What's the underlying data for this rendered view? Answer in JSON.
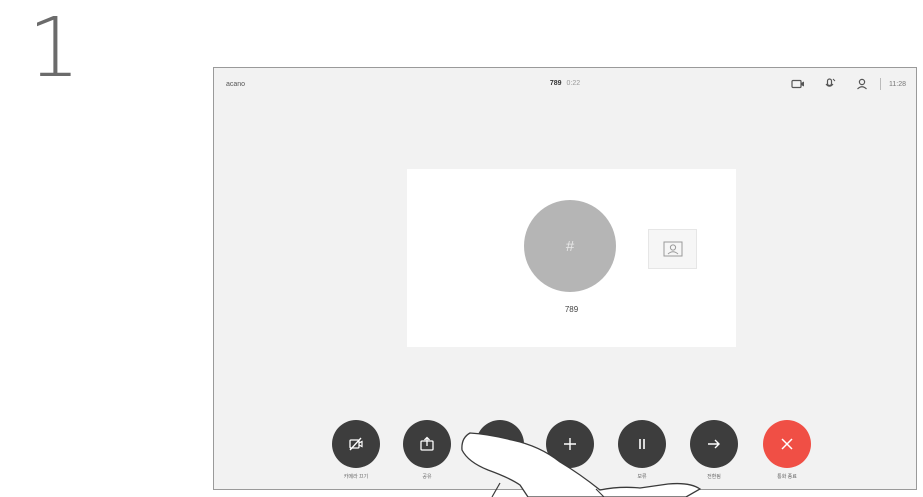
{
  "step_number": "1",
  "topbar": {
    "brand": "acano",
    "call_name": "789",
    "call_duration": "0:22",
    "time": "11:28",
    "icons": [
      "camera-icon",
      "microphone-icon",
      "user-icon"
    ]
  },
  "call": {
    "avatar_symbol": "#",
    "participant_name": "789"
  },
  "controls": [
    {
      "name": "camera-off-button",
      "icon": "camera-off-icon",
      "label": "카메라 끄기",
      "color": "#3d3d3d"
    },
    {
      "name": "share-button",
      "icon": "share-icon",
      "label": "공유",
      "color": "#3d3d3d"
    },
    {
      "name": "hidden-button",
      "icon": "",
      "label": "",
      "color": "#3d3d3d"
    },
    {
      "name": "add-button",
      "icon": "plus-icon",
      "label": "",
      "color": "#3d3d3d"
    },
    {
      "name": "hold-button",
      "icon": "pause-icon",
      "label": "보류",
      "color": "#3d3d3d"
    },
    {
      "name": "transfer-button",
      "icon": "arrow-right-icon",
      "label": "전환됨",
      "color": "#3d3d3d"
    },
    {
      "name": "end-call-button",
      "icon": "close-icon",
      "label": "통화 종료",
      "color": "#f04f45"
    }
  ]
}
